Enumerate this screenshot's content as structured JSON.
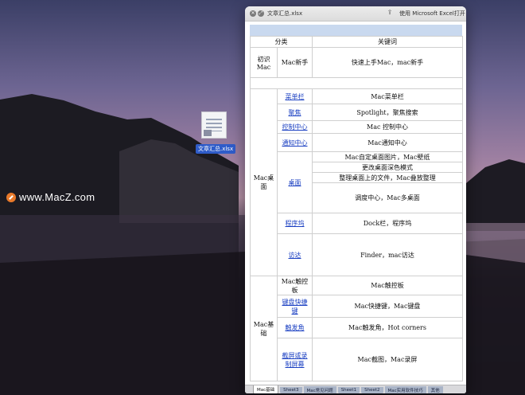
{
  "desktop": {
    "file_label": "文章汇总.xlsx",
    "watermark": "www.MacZ.com"
  },
  "window": {
    "title": "文章汇总.xlsx",
    "open_in_excel": "使用 Microsoft Excel打开"
  },
  "sheet": {
    "header": {
      "category": "分类",
      "keyword": "关键词"
    },
    "rows": [
      {
        "group": "初识Mac",
        "sub": "Mac新手",
        "keyword": "快速上手Mac，mac新手"
      },
      {
        "group": "Mac桌面",
        "sub": "菜单栏",
        "keyword": "Mac菜单栏"
      },
      {
        "sub": "聚焦",
        "keyword": "Spotlight，聚焦搜索"
      },
      {
        "sub": "控制中心",
        "keyword": "Mac 控制中心"
      },
      {
        "sub": "通知中心",
        "keyword": "Mac通知中心"
      },
      {
        "sub": "桌面",
        "keyword": "Mac自定桌面图片，Mac壁纸"
      },
      {
        "keyword": "更改桌面深色模式"
      },
      {
        "keyword": "整理桌面上的文件，Mac叠放整理"
      },
      {
        "keyword": "调度中心，Mac多桌面"
      },
      {
        "sub": "程序坞",
        "keyword": "Dock栏，程序坞"
      },
      {
        "sub": "访达",
        "keyword": "Finder，mac访达"
      },
      {
        "group": "Mac基础",
        "sub": "Mac触控板",
        "keyword": "Mac触控板"
      },
      {
        "sub": "键盘快捷键",
        "keyword": "Mac快捷键，Mac键盘"
      },
      {
        "sub": "触发角",
        "keyword": "Mac触发角，Hot corners"
      },
      {
        "sub": "截屏或录制屏幕",
        "keyword": "Mac截图，Mac录屏"
      }
    ]
  },
  "tabs": [
    "Mac基础",
    "Sheet3",
    "Mac常见问题",
    "Sheet1",
    "Sheet2",
    "Mac实用软件技巧",
    "其他"
  ]
}
